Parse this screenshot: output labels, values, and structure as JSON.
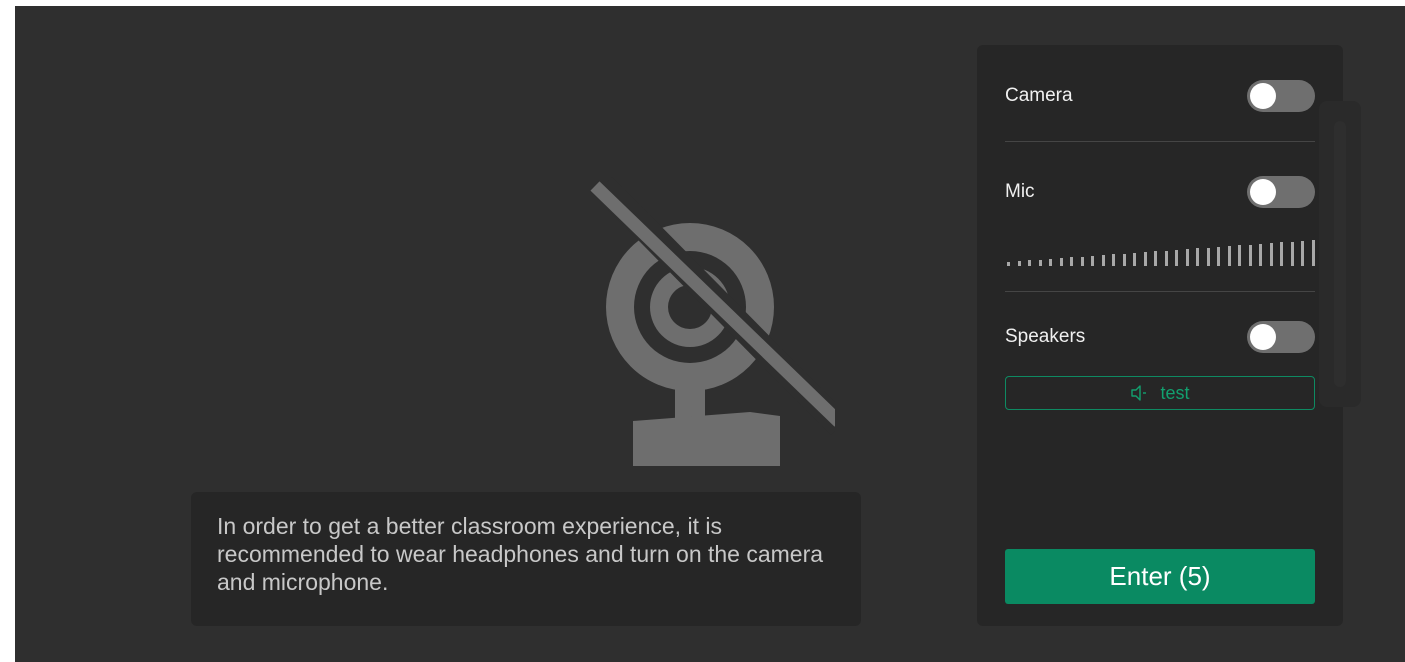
{
  "preview": {
    "camera_state_icon": "camera-off-icon",
    "tip_text": "In order to get a better classroom experience, it is recommended to wear headphones and turn on the camera and microphone."
  },
  "settings": {
    "camera": {
      "label": "Camera",
      "enabled": false
    },
    "mic": {
      "label": "Mic",
      "enabled": false,
      "level_bar_count": 30,
      "level_lit_bars": 0
    },
    "speakers": {
      "label": "Speakers",
      "enabled": false,
      "test_label": "test",
      "test_icon": "speaker-icon"
    },
    "enter_label": "Enter (5)"
  },
  "colors": {
    "background": "#2f2f2f",
    "panel": "#262626",
    "accent": "#0a8a62",
    "toggle_off": "#6f6f6f"
  }
}
